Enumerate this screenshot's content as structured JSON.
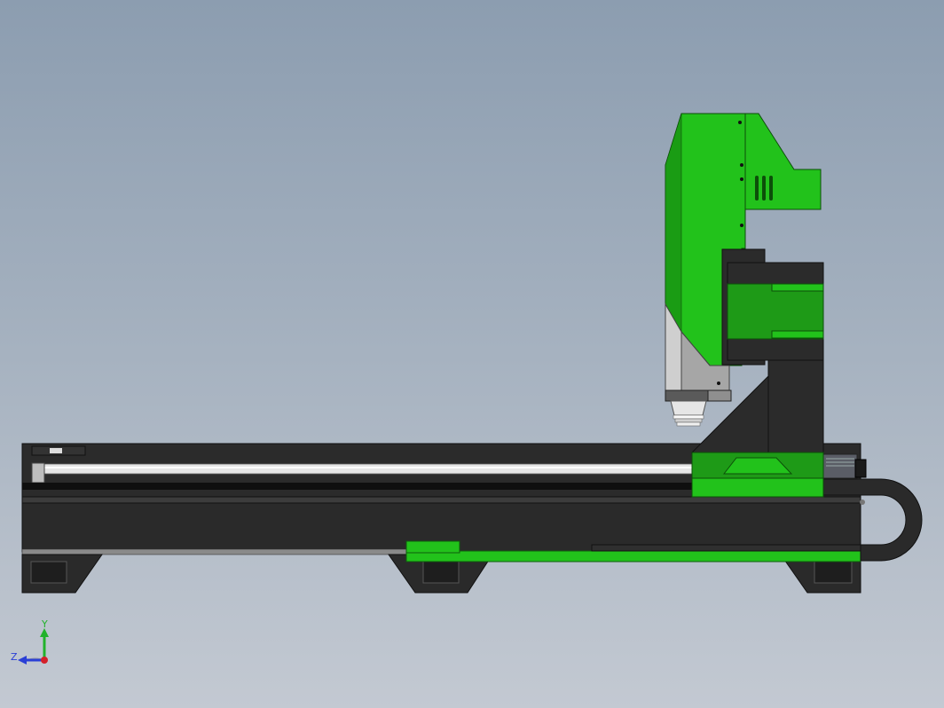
{
  "viewport": {
    "background_top": "#8c9db0",
    "background_bottom": "#c3c9d2"
  },
  "model": {
    "accent_green": "#22c21b",
    "frame_dark": "#2a2a2a",
    "rail_steel": "#d8d8d8"
  },
  "triad": {
    "y_label": "Y",
    "z_label": "Z",
    "y_color": "#22b22b",
    "z_color": "#2a3fd6",
    "x_color": "#d4202a"
  }
}
